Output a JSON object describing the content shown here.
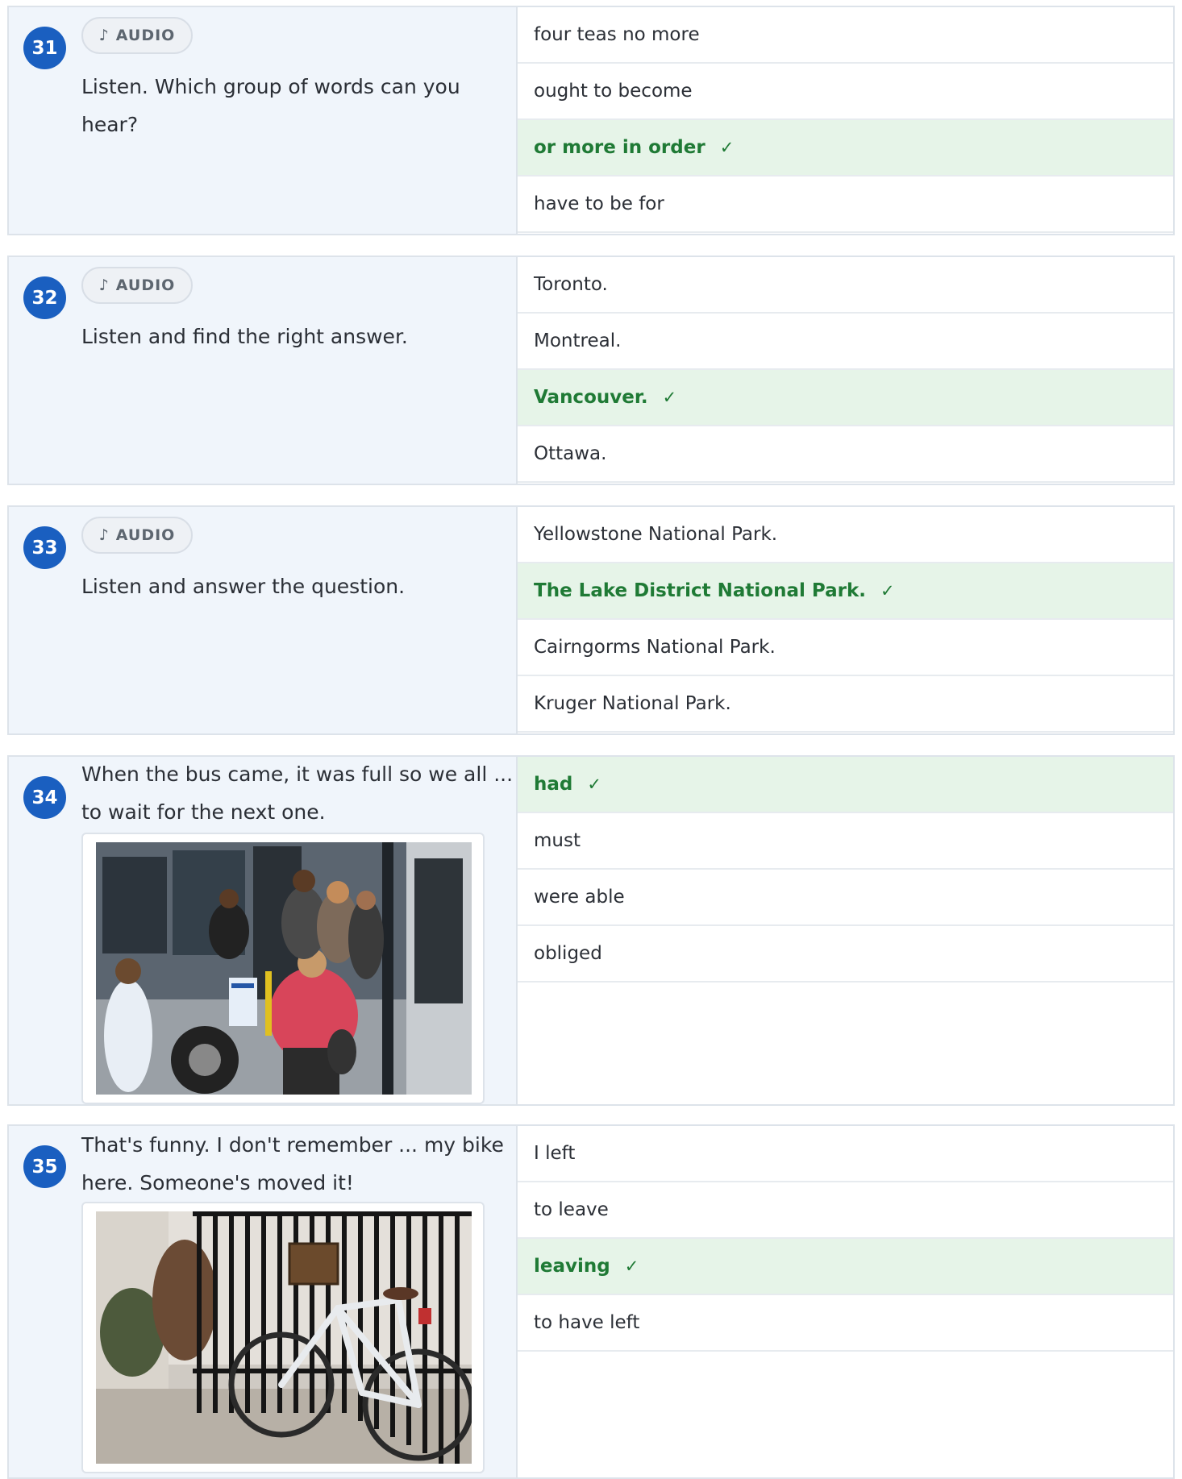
{
  "audio_label": "AUDIO",
  "audio_icon": "music-note-icon",
  "check_mark": "✓",
  "colors": {
    "number_badge": "#1a5fc0",
    "correct_bg": "#e6f4e8",
    "correct_text": "#1f7a35",
    "left_panel_bg": "#f0f5fb"
  },
  "questions": [
    {
      "number": "31",
      "prompt": "Listen. Which group of words can you hear?",
      "options": [
        "four teas no more",
        "ought to become",
        "or more in order",
        "have to be for"
      ]
    },
    {
      "number": "32",
      "prompt": "Listen and find the right answer.",
      "options": [
        "Toronto.",
        "Montreal.",
        "Vancouver.",
        "Ottawa."
      ]
    },
    {
      "number": "33",
      "prompt": "Listen and answer the question.",
      "options": [
        "Yellowstone National Park.",
        "The Lake District National Park.",
        "Cairngorms National Park.",
        "Kruger National Park."
      ]
    },
    {
      "number": "34",
      "prompt": "When the bus came, it was full so we all ... to wait for the next one.",
      "options": [
        "had",
        "must",
        "were able",
        "obliged"
      ]
    },
    {
      "number": "35",
      "prompt": "That's funny. I don't remember ... my bike here. Someone's moved it!",
      "options": [
        "I left",
        "to leave",
        "leaving",
        "to have left"
      ]
    }
  ]
}
